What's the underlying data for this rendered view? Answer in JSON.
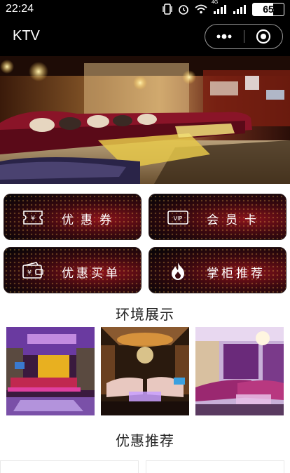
{
  "status_bar": {
    "time": "22:24",
    "battery": "65",
    "network": "4G"
  },
  "titlebar": {
    "title": "KTV",
    "more_icon": "more-dots-icon",
    "close_icon": "target-icon"
  },
  "hero": {
    "alt": "KTV room interior"
  },
  "menu": [
    {
      "label": "优惠券",
      "icon": "coupon-ticket-icon"
    },
    {
      "label": "会员卡",
      "icon": "vip-card-icon"
    },
    {
      "label": "优惠买单",
      "icon": "wallet-icon"
    },
    {
      "label": "掌柜推荐",
      "icon": "flame-icon"
    }
  ],
  "vip_text": "VIP",
  "sections": {
    "environment": "环境展示",
    "promotions": "优惠推荐"
  }
}
